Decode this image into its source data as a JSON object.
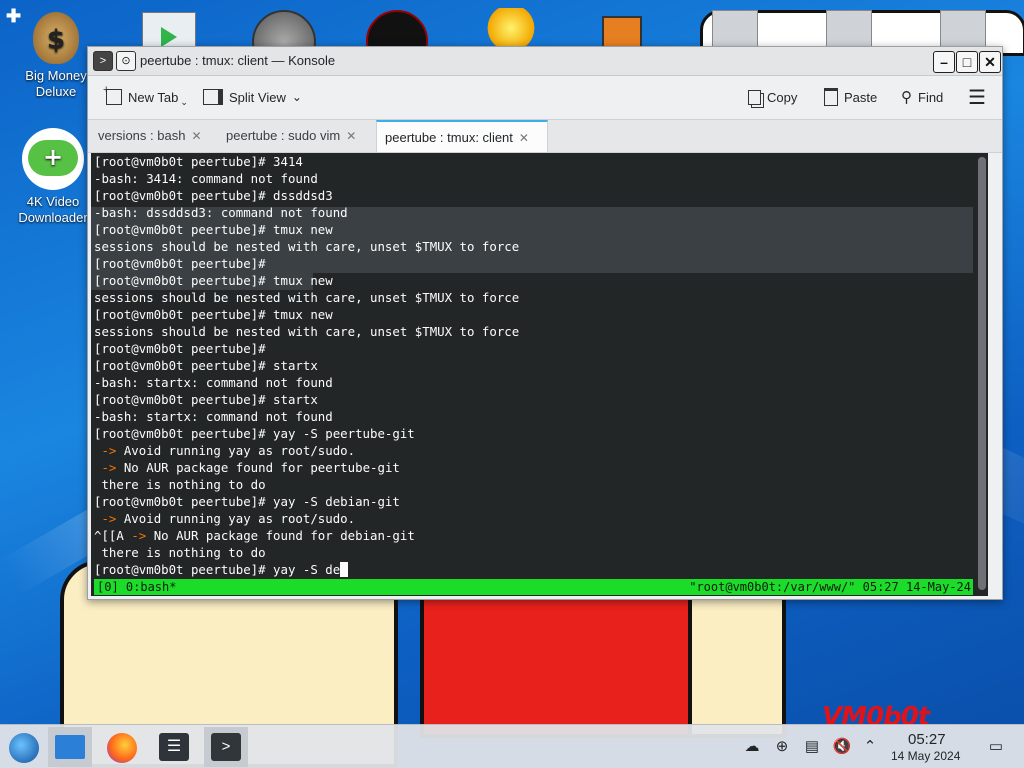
{
  "desktop": {
    "icons": [
      {
        "label_line1": "Big Money",
        "label_line2": "Deluxe"
      },
      {
        "label_line1": "4K Video",
        "label_line2": "Downloader"
      }
    ],
    "wallpaper_logo": "VM0b0t"
  },
  "window": {
    "title": "peertube : tmux: client — Konsole",
    "toolbar": {
      "new_tab": "New Tab",
      "split_view": "Split View",
      "copy": "Copy",
      "paste": "Paste",
      "find": "Find"
    },
    "tabs": [
      {
        "label": "versions : bash"
      },
      {
        "label": "peertube : sudo vim"
      },
      {
        "label": "peertube : tmux: client"
      }
    ]
  },
  "terminal": {
    "lines": [
      "[root@vm0b0t peertube]# 3414",
      "-bash: 3414: command not found",
      "[root@vm0b0t peertube]# dssddsd3",
      "-bash: dssddsd3: command not found",
      "[root@vm0b0t peertube]# tmux new",
      "sessions should be nested with care, unset $TMUX to force",
      "[root@vm0b0t peertube]#",
      "[root@vm0b0t peertube]# tmux new",
      "sessions should be nested with care, unset $TMUX to force",
      "[root@vm0b0t peertube]# tmux new",
      "sessions should be nested with care, unset $TMUX to force",
      "[root@vm0b0t peertube]#",
      "[root@vm0b0t peertube]# startx",
      "-bash: startx: command not found",
      "[root@vm0b0t peertube]# startx",
      "-bash: startx: command not found",
      "[root@vm0b0t peertube]# yay -S peertube-git",
      " -> Avoid running yay as root/sudo.",
      " -> No AUR package found for peertube-git",
      " there is nothing to do",
      "[root@vm0b0t peertube]# yay -S debian-git",
      " -> Avoid running yay as root/sudo.",
      "^[[A -> No AUR package found for debian-git",
      " there is nothing to do"
    ],
    "prompt_line": "[root@vm0b0t peertube]# yay -S de",
    "status_left": "[0] 0:bash*",
    "status_right": "\"root@vm0b0t:/var/www/\" 05:27 14-May-24"
  },
  "taskbar": {
    "time": "05:27",
    "date": "14 May 2024"
  }
}
